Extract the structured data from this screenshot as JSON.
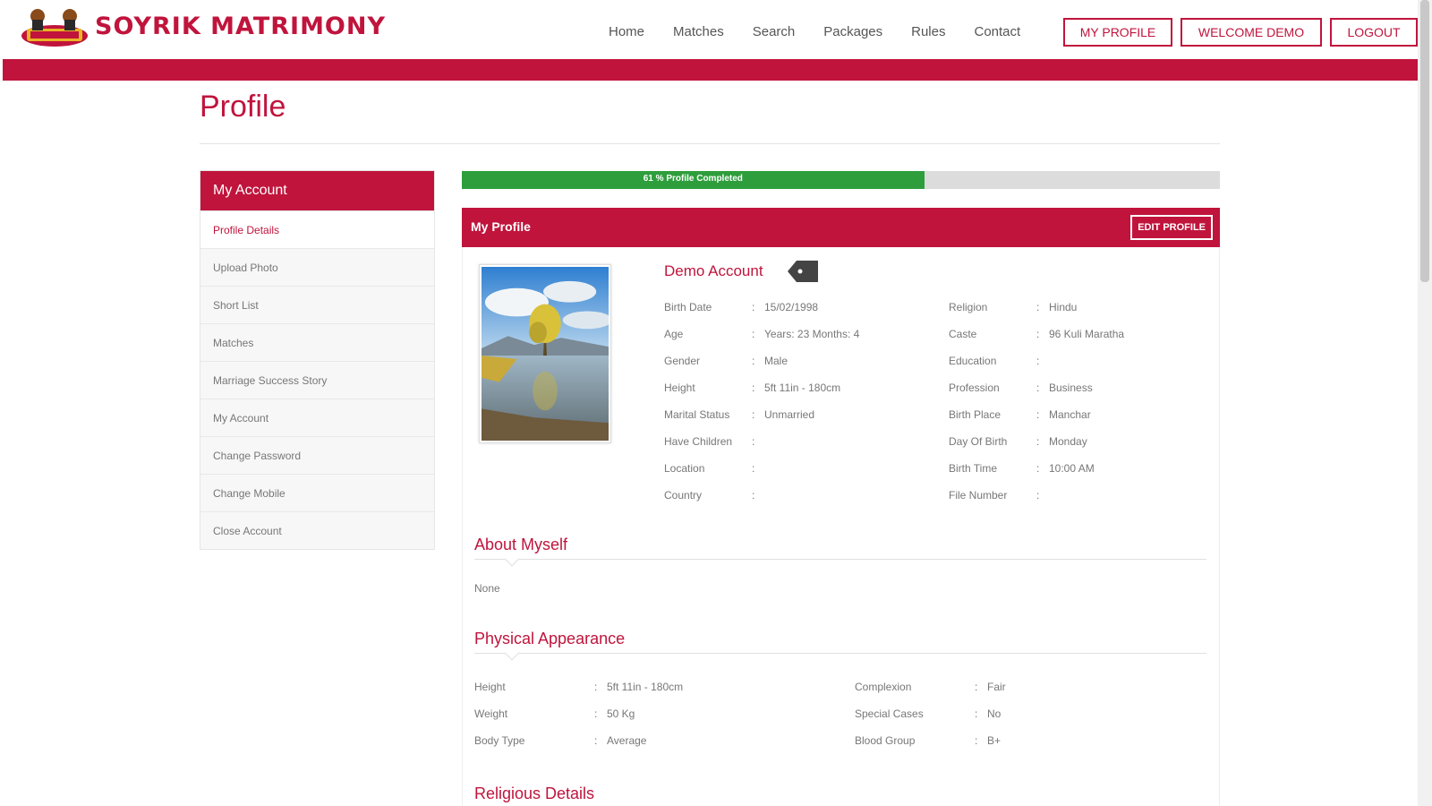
{
  "header": {
    "brand": "SOYRIK MATRIMONY",
    "nav": [
      "Home",
      "Matches",
      "Search",
      "Packages",
      "Rules",
      "Contact"
    ],
    "buttons": {
      "my_profile": "MY PROFILE",
      "welcome": "WELCOME DEMO",
      "logout": "LOGOUT"
    }
  },
  "page_title": "Profile",
  "sidebar": {
    "heading": "My Account",
    "items": [
      "Profile Details",
      "Upload Photo",
      "Short List",
      "Matches",
      "Marriage Success Story",
      "My Account",
      "Change Password",
      "Change Mobile",
      "Close Account"
    ]
  },
  "progress": {
    "label": "61 % Profile Completed",
    "fraction": 0.61
  },
  "panel": {
    "title": "My Profile",
    "edit_label": "EDIT PROFILE"
  },
  "profile": {
    "name": "Demo Account",
    "left": [
      {
        "k": "Birth Date",
        "v": "15/02/1998"
      },
      {
        "k": "Age",
        "v": "Years: 23 Months: 4"
      },
      {
        "k": "Gender",
        "v": "Male"
      },
      {
        "k": "Height",
        "v": "5ft 11in - 180cm"
      },
      {
        "k": "Marital Status",
        "v": "Unmarried"
      },
      {
        "k": "Have Children",
        "v": ""
      },
      {
        "k": "Location",
        "v": ""
      },
      {
        "k": "Country",
        "v": ""
      }
    ],
    "right": [
      {
        "k": "Religion",
        "v": "Hindu"
      },
      {
        "k": "Caste",
        "v": "96 Kuli Maratha"
      },
      {
        "k": "Education",
        "v": ""
      },
      {
        "k": "Profession",
        "v": "Business"
      },
      {
        "k": "Birth Place",
        "v": "Manchar"
      },
      {
        "k": "Day Of Birth",
        "v": "Monday"
      },
      {
        "k": "Birth Time",
        "v": "10:00 AM"
      },
      {
        "k": "File Number",
        "v": ""
      }
    ]
  },
  "about": {
    "title": "About Myself",
    "text": "None"
  },
  "physical": {
    "title": "Physical Appearance",
    "left": [
      {
        "k": "Height",
        "v": "5ft 11in - 180cm"
      },
      {
        "k": "Weight",
        "v": "50 Kg"
      },
      {
        "k": "Body Type",
        "v": "Average"
      }
    ],
    "right": [
      {
        "k": "Complexion",
        "v": "Fair"
      },
      {
        "k": "Special Cases",
        "v": "No"
      },
      {
        "k": "Blood Group",
        "v": "B+"
      }
    ]
  },
  "religious": {
    "title": "Religious Details"
  },
  "colors": {
    "brand_red": "#c0143c",
    "progress_green": "#2e9e3c"
  }
}
